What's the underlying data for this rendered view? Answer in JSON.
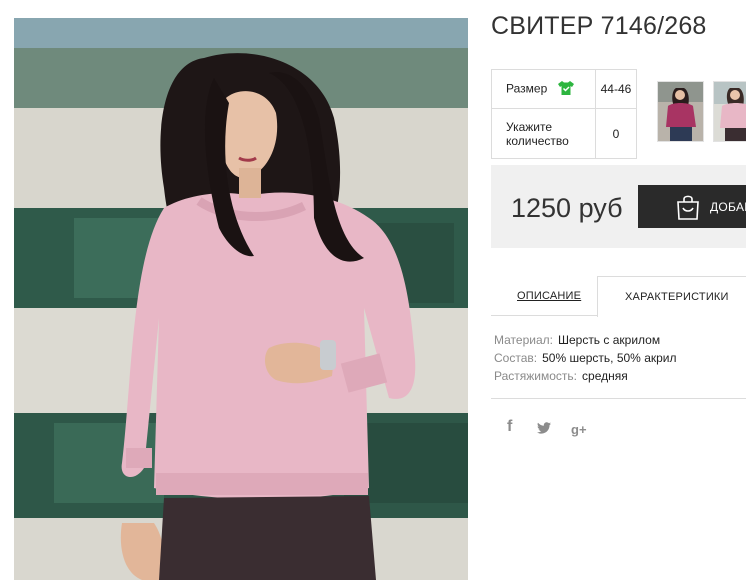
{
  "product": {
    "title": "СВИТЕР 7146/268"
  },
  "options": {
    "size_label": "Размер",
    "size_value": "44-46",
    "quantity_label_line1": "Укажите",
    "quantity_label_line2": "количество",
    "quantity_value": "0"
  },
  "price": {
    "text": "1250 руб"
  },
  "cart": {
    "button_label": "ДОБАВИТЬ В КОРЗИНУ"
  },
  "tabs": {
    "description": "ОПИСАНИЕ",
    "characteristics": "ХАРАКТЕРИСТИКИ"
  },
  "specs": [
    {
      "key": "Материал:",
      "value": "Шерсть с акрилом"
    },
    {
      "key": "Состав:",
      "value": "50% шерсть, 50% акрил"
    },
    {
      "key": "Растяжимость:",
      "value": "средняя"
    }
  ],
  "social": {
    "facebook": "f",
    "google_plus": "g+"
  },
  "colors": {
    "accent_green": "#2db53f",
    "button_dark": "#2a2a2a",
    "price_bg": "#f0f0f0",
    "sweater_pink": "#e8b7c6"
  },
  "icons": [
    "shirt-icon",
    "shopping-bag-icon",
    "facebook-icon",
    "twitter-icon",
    "google-plus-icon"
  ]
}
